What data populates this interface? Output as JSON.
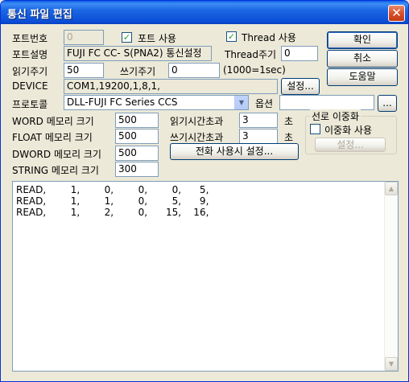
{
  "window": {
    "title": "통신 파일 편집",
    "close_glyph": "✕"
  },
  "port": {
    "number_label": "포트번호",
    "number_value": "0",
    "use_label": "포트 사용",
    "thread_label": "Thread 사용",
    "desc_label": "포트설명",
    "desc_value": "FUJI FC CC- S(PNA2) 통신설정",
    "thread_period_label": "Thread주기",
    "thread_period_value": "0"
  },
  "cycle": {
    "read_label": "읽기주기",
    "read_value": "50",
    "write_label": "쓰기주기",
    "write_value": "0",
    "unit_note": "(1000=1sec)"
  },
  "device": {
    "label": "DEVICE",
    "value": "COM1,19200,1,8,1,",
    "settings_button": "설정..."
  },
  "protocol": {
    "label": "프로토콜",
    "value": "DLL-FUJI FC Series CCS",
    "option_label": "옵션",
    "option_value": "",
    "browse_button": "..."
  },
  "memory": {
    "word_label": "WORD 메모리 크기",
    "word_value": "500",
    "float_label": "FLOAT 메모리 크기",
    "float_value": "500",
    "dword_label": "DWORD 메모리 크기",
    "dword_value": "500",
    "string_label": "STRING 메모리 크기",
    "string_value": "300"
  },
  "timeouts": {
    "read_label": "읽기시간초과",
    "read_value": "3",
    "read_unit": "초",
    "write_label": "쓰기시간초과",
    "write_value": "3",
    "write_unit": "초",
    "phone_button": "전화 사용시 설정..."
  },
  "redundancy": {
    "group_label": "선로 이중화",
    "use_label": "이중화 사용",
    "settings_button": "설정..."
  },
  "buttons": {
    "ok": "확인",
    "cancel": "취소",
    "help": "도움말"
  },
  "memo_lines": [
    "READ,        1,        0,        0,        0,      5,",
    "READ,        1,        1,        0,        5,      9,",
    "READ,        1,        2,        0,      15,    16,"
  ],
  "icons": {
    "check": "✓",
    "dropdown": "▼",
    "scroll_up": "▲",
    "scroll_down": "▼"
  }
}
